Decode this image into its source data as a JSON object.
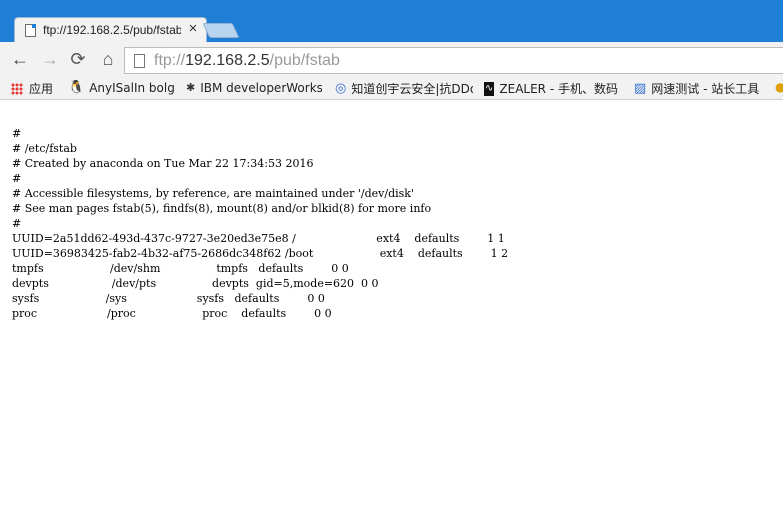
{
  "tab": {
    "title": "ftp://192.168.2.5/pub/fstab",
    "close_glyph": "×"
  },
  "toolbar": {
    "back_glyph": "←",
    "forward_glyph": "→",
    "reload_glyph": "⟳",
    "home_glyph": "⌂"
  },
  "address": {
    "scheme": "ftp://",
    "host": "192.168.2.5",
    "path": "/pub/fstab"
  },
  "bookmarks": [
    {
      "label": "应用",
      "icon": "apps-grid-icon"
    },
    {
      "label": "AnyISalIn bolg",
      "icon": "linux-penguin-icon"
    },
    {
      "label": "IBM developerWorks",
      "icon": "ibm-icon"
    },
    {
      "label": "知道创宇云安全|抗DDoS",
      "icon": "swirl-icon"
    },
    {
      "label": "ZEALER - 手机、数码",
      "icon": "zealer-icon"
    },
    {
      "label": "网速测试 - 站长工具",
      "icon": "speedtest-icon"
    }
  ],
  "file": {
    "lines": [
      "#",
      "# /etc/fstab",
      "# Created by anaconda on Tue Mar 22 17:34:53 2016",
      "#",
      "# Accessible filesystems, by reference, are maintained under '/dev/disk'",
      "# See man pages fstab(5), findfs(8), mount(8) and/or blkid(8) for more info",
      "#",
      "UUID=2a51dd62-493d-437c-9727-3e20ed3e75e8 /                       ext4    defaults        1 1",
      "UUID=36983425-fab2-4b32-af75-2686dc348f62 /boot                   ext4    defaults        1 2",
      "tmpfs                   /dev/shm                tmpfs   defaults        0 0",
      "devpts                  /dev/pts                devpts  gid=5,mode=620  0 0",
      "sysfs                   /sys                    sysfs   defaults        0 0",
      "proc                    /proc                   proc    defaults        0 0"
    ]
  },
  "colors": {
    "titlebar": "#1f7fd6",
    "chrome": "#f2f2f2"
  }
}
